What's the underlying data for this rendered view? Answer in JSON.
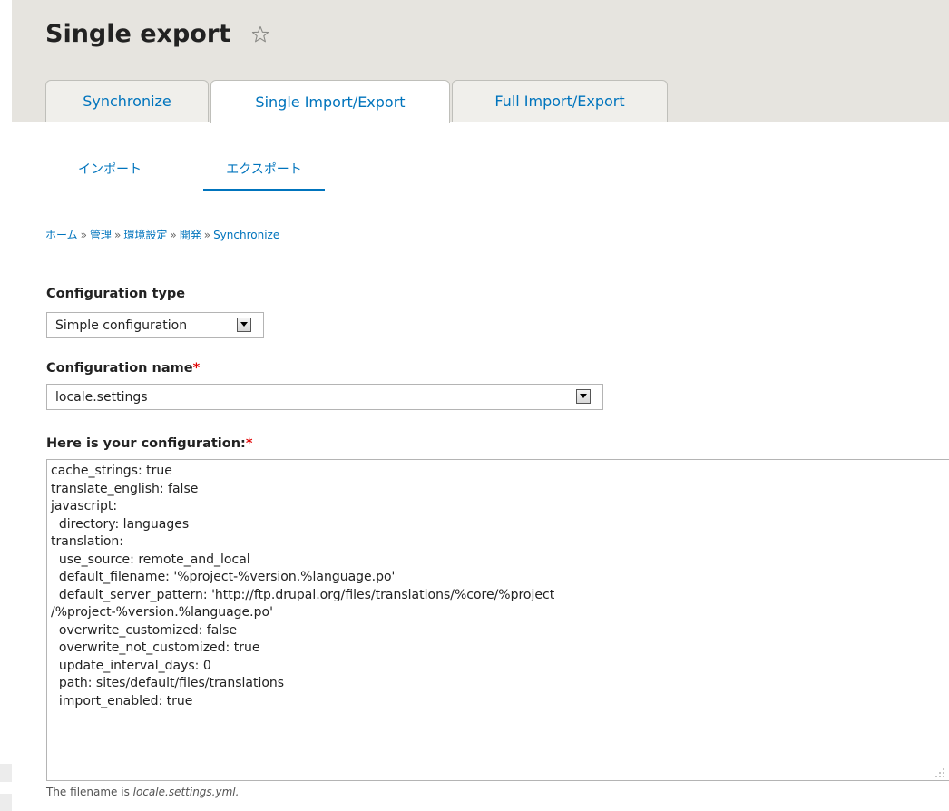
{
  "page": {
    "title": "Single export",
    "star_icon": "star-outline-icon"
  },
  "tabs": [
    {
      "label": "Synchronize",
      "active": false
    },
    {
      "label": "Single Import/Export",
      "active": true
    },
    {
      "label": "Full Import/Export",
      "active": false
    }
  ],
  "secondary_tabs": [
    {
      "label": "インポート",
      "active": false
    },
    {
      "label": "エクスポート",
      "active": true
    }
  ],
  "breadcrumb": {
    "items": [
      "ホーム",
      "管理",
      "環境設定",
      "開発",
      "Synchronize"
    ],
    "separator": "»"
  },
  "form": {
    "config_type": {
      "label": "Configuration type",
      "value": "Simple configuration"
    },
    "config_name": {
      "label": "Configuration name",
      "required_mark": "*",
      "value": "locale.settings"
    },
    "config_text": {
      "label": "Here is your configuration:",
      "required_mark": "*",
      "value": "cache_strings: true\ntranslate_english: false\njavascript:\n  directory: languages\ntranslation:\n  use_source: remote_and_local\n  default_filename: '%project-%version.%language.po'\n  default_server_pattern: 'http://ftp.drupal.org/files/translations/%core/%project\n/%project-%version.%language.po'\n  overwrite_customized: false\n  overwrite_not_customized: true\n  update_interval_days: 0\n  path: sites/default/files/translations\n  import_enabled: true"
    },
    "filename_note": {
      "prefix": "The filename is ",
      "filename": "locale.settings.yml."
    }
  },
  "colors": {
    "link": "#0074bd",
    "header_bg": "#e6e4df",
    "required": "#e00000"
  }
}
